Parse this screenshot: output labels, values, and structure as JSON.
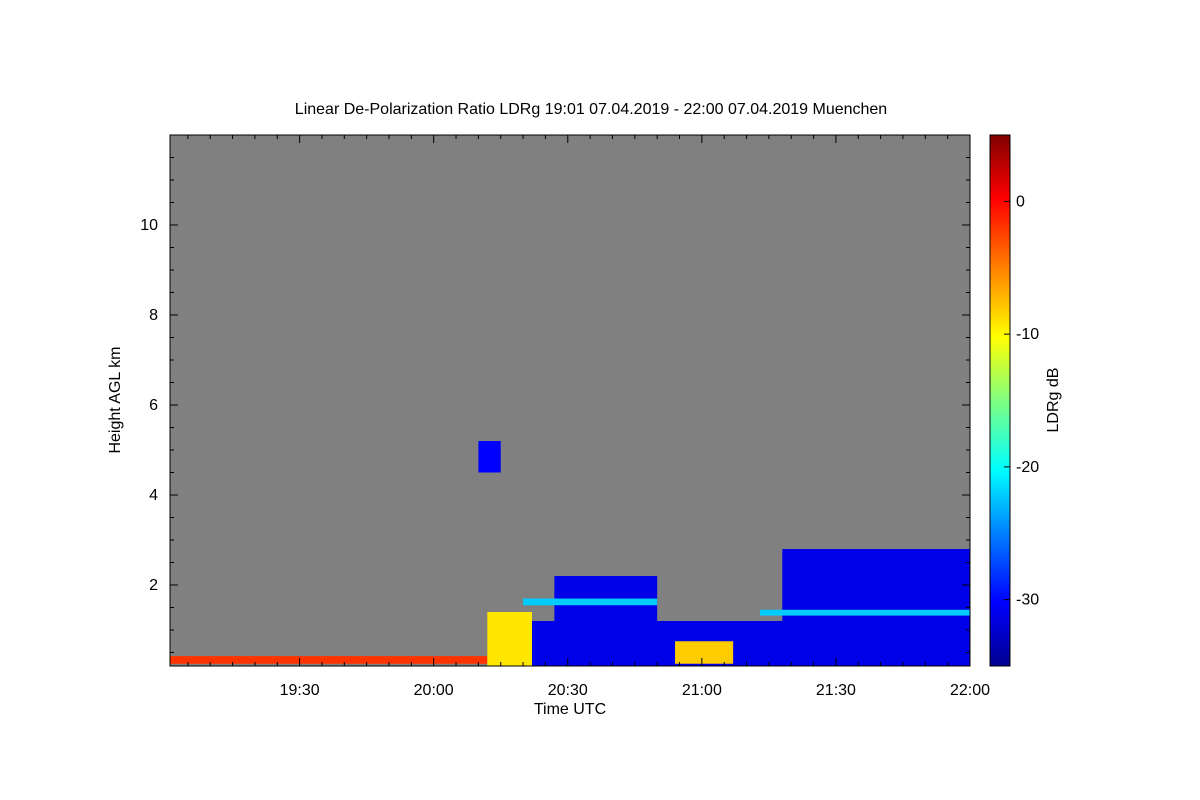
{
  "chart_data": {
    "type": "heatmap",
    "title": "Linear De-Polarization Ratio LDRg   19:01 07.04.2019 - 22:00 07.04.2019 Muenchen",
    "xlabel": "Time UTC",
    "ylabel": "Height AGL km",
    "x_tick_labels": [
      "19:30",
      "20:00",
      "20:30",
      "21:00",
      "21:30",
      "22:00"
    ],
    "x_tick_minutes": [
      1170,
      1200,
      1230,
      1260,
      1290,
      1320
    ],
    "xlim_minutes": [
      1141,
      1320
    ],
    "y_ticks": [
      2,
      4,
      6,
      8,
      10
    ],
    "ylim": [
      0.2,
      12
    ],
    "background_color": "#808080",
    "colorbar": {
      "label": "LDRg dB",
      "ticks": [
        0,
        -10,
        -20,
        -30
      ],
      "range": [
        -35,
        5
      ],
      "colors": [
        "#00008f",
        "#0000ff",
        "#0080ff",
        "#00ffff",
        "#80ff80",
        "#ffff00",
        "#ff8000",
        "#ff0000",
        "#800000"
      ]
    },
    "features": [
      {
        "x_start": 1141,
        "x_end": 1212,
        "y_start": 0.25,
        "y_end": 0.42,
        "ldr": -2
      },
      {
        "x_start": 1212,
        "x_end": 1222,
        "y_start": 0.2,
        "y_end": 1.4,
        "ldr": -9
      },
      {
        "x_start": 1222,
        "x_end": 1320,
        "y_start": 0.2,
        "y_end": 1.2,
        "ldr": -31
      },
      {
        "x_start": 1227,
        "x_end": 1250,
        "y_start": 0.2,
        "y_end": 2.2,
        "ldr": -31
      },
      {
        "x_start": 1278,
        "x_end": 1320,
        "y_start": 0.2,
        "y_end": 2.8,
        "ldr": -31
      },
      {
        "x_start": 1254,
        "x_end": 1267,
        "y_start": 0.25,
        "y_end": 0.75,
        "ldr": -8
      },
      {
        "x_start": 1220,
        "x_end": 1250,
        "y_start": 1.55,
        "y_end": 1.7,
        "ldr": -22
      },
      {
        "x_start": 1273,
        "x_end": 1320,
        "y_start": 1.32,
        "y_end": 1.45,
        "ldr": -22
      },
      {
        "x_start": 1210,
        "x_end": 1215,
        "y_start": 4.5,
        "y_end": 5.2,
        "ldr": -30
      }
    ]
  }
}
